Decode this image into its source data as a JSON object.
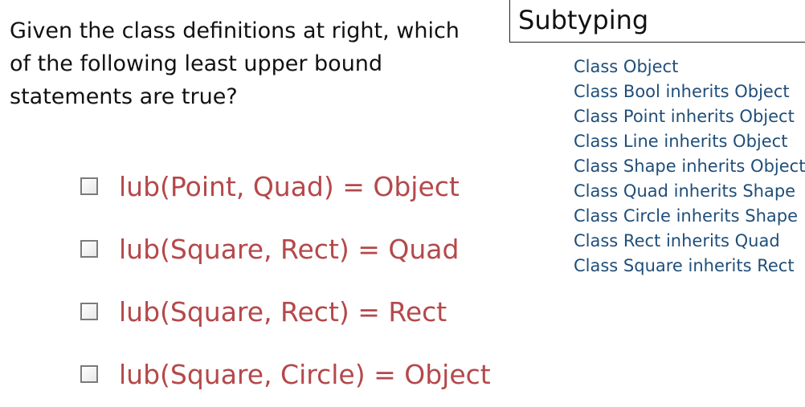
{
  "question": {
    "text": "Given the class definitions at right, which\nof the following least upper bound\nstatements are true?"
  },
  "options": [
    {
      "label": "lub(Point, Quad) = Object",
      "checked": false
    },
    {
      "label": "lub(Square, Rect) = Quad",
      "checked": false
    },
    {
      "label": "lub(Square, Rect) = Rect",
      "checked": false
    },
    {
      "label": "lub(Square, Circle) = Object",
      "checked": false
    }
  ],
  "panel": {
    "title": "Subtyping",
    "definitions": [
      "Class Object",
      "Class Bool inherits Object",
      "Class Point inherits Object",
      "Class Line inherits Object",
      "Class Shape inherits Object",
      "Class Quad inherits Shape",
      "Class Circle inherits Shape",
      "Class Rect inherits Quad",
      "Class Square inherits Rect"
    ]
  },
  "colors": {
    "option_text": "#b5484a",
    "definition_text": "#1f4e79",
    "body_text": "#111111"
  }
}
